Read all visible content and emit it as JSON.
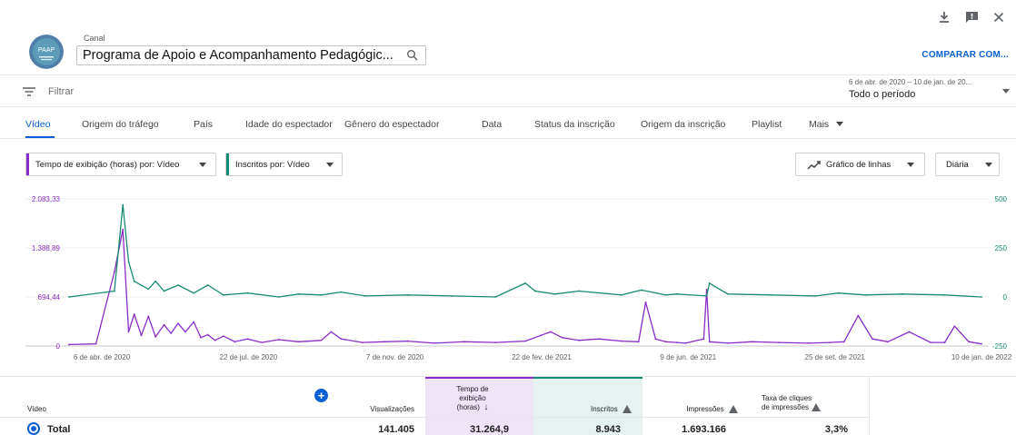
{
  "header": {
    "channel_caption": "Canal",
    "channel_name": "Programa de Apoio e Acompanhamento Pedagógic...",
    "compare_label": "COMPARAR COM...",
    "logo_text": "PAAP"
  },
  "filter": {
    "label": "Filtrar"
  },
  "date_range": {
    "range_text": "6 de abr. de 2020 – 10 de jan. de 20...",
    "period_label": "Todo o período"
  },
  "tabs": [
    {
      "label": "Vídeo",
      "active": true
    },
    {
      "label": "Origem do tráfego"
    },
    {
      "label": "País"
    },
    {
      "label": "Idade do espectador"
    },
    {
      "label": "Gênero do espectador"
    },
    {
      "label": "Data"
    },
    {
      "label": "Status da inscrição"
    },
    {
      "label": "Origem da inscrição"
    },
    {
      "label": "Playlist"
    },
    {
      "label": "Mais"
    }
  ],
  "controls": {
    "metric1_label": "Tempo de exibição (horas) por: Vídeo",
    "metric2_label": "Inscritos por: Vídeo",
    "chart_type_label": "Gráfico de linhas",
    "granularity_label": "Diária"
  },
  "colors": {
    "accent": "#065fd4",
    "metric1": "#8a2dc8",
    "metric2": "#178a73",
    "metric1_bg": "#efe3f6",
    "metric2_bg": "#e6f2ef"
  },
  "chart_data": {
    "type": "line",
    "x_tick_labels": [
      "6 de abr. de 2020",
      "22 de jul. de 2020",
      "7 de nov. de 2020",
      "22 de fev. de 2021",
      "9 de jun. de 2021",
      "25 de set. de 2021",
      "10 de jan. de 2022"
    ],
    "x_range": [
      "2020-04-06",
      "2022-01-10"
    ],
    "y_left": {
      "tick_labels": [
        "2.083,33",
        "1.388,89",
        "694,44",
        "0"
      ],
      "range": [
        0,
        2083.33
      ]
    },
    "y_right": {
      "tick_labels": [
        "500",
        "250",
        "0",
        "-250"
      ],
      "range": [
        -250,
        500
      ]
    },
    "grid": true,
    "series": [
      {
        "name": "Tempo de exibição (horas)",
        "axis": "left",
        "color": "#8a2dc8",
        "x": [
          "2020-04-06",
          "2020-04-25",
          "2020-05-08",
          "2020-05-14",
          "2020-05-18",
          "2020-05-22",
          "2020-05-27",
          "2020-06-01",
          "2020-06-06",
          "2020-06-12",
          "2020-06-17",
          "2020-06-22",
          "2020-06-27",
          "2020-07-03",
          "2020-07-08",
          "2020-07-13",
          "2020-07-18",
          "2020-07-24",
          "2020-08-01",
          "2020-08-10",
          "2020-08-20",
          "2020-09-01",
          "2020-09-15",
          "2020-10-01",
          "2020-10-08",
          "2020-10-15",
          "2020-10-30",
          "2020-11-15",
          "2020-12-01",
          "2020-12-20",
          "2021-01-10",
          "2021-02-01",
          "2021-02-22",
          "2021-03-05",
          "2021-03-12",
          "2021-03-20",
          "2021-04-01",
          "2021-04-15",
          "2021-05-01",
          "2021-05-13",
          "2021-05-18",
          "2021-05-25",
          "2021-06-01",
          "2021-06-09",
          "2021-06-15",
          "2021-06-28",
          "2021-06-30",
          "2021-07-02",
          "2021-07-15",
          "2021-08-01",
          "2021-08-20",
          "2021-09-10",
          "2021-09-25",
          "2021-10-05",
          "2021-10-15",
          "2021-10-25",
          "2021-11-05",
          "2021-11-20",
          "2021-12-05",
          "2021-12-15",
          "2021-12-22",
          "2022-01-01",
          "2022-01-10"
        ],
        "values": [
          20,
          30,
          1050,
          1650,
          200,
          450,
          150,
          420,
          130,
          300,
          180,
          320,
          200,
          340,
          120,
          160,
          80,
          140,
          60,
          100,
          50,
          90,
          60,
          80,
          200,
          100,
          50,
          60,
          70,
          40,
          60,
          50,
          70,
          150,
          200,
          120,
          80,
          100,
          70,
          60,
          620,
          100,
          60,
          50,
          40,
          100,
          800,
          60,
          40,
          60,
          50,
          40,
          50,
          60,
          430,
          100,
          60,
          200,
          50,
          50,
          280,
          60,
          30
        ]
      },
      {
        "name": "Inscritos",
        "axis": "right",
        "color": "#178a73",
        "x": [
          "2020-04-06",
          "2020-05-08",
          "2020-05-14",
          "2020-05-18",
          "2020-05-22",
          "2020-06-01",
          "2020-06-06",
          "2020-06-12",
          "2020-06-22",
          "2020-07-03",
          "2020-07-13",
          "2020-07-24",
          "2020-08-10",
          "2020-09-01",
          "2020-09-15",
          "2020-10-01",
          "2020-10-15",
          "2020-11-01",
          "2020-12-01",
          "2021-01-01",
          "2021-02-01",
          "2021-02-22",
          "2021-03-01",
          "2021-03-15",
          "2021-04-01",
          "2021-05-01",
          "2021-05-15",
          "2021-06-01",
          "2021-06-09",
          "2021-06-30",
          "2021-07-02",
          "2021-07-15",
          "2021-08-15",
          "2021-09-15",
          "2021-10-01",
          "2021-10-20",
          "2021-11-15",
          "2021-12-15",
          "2022-01-10"
        ],
        "values": [
          0,
          30,
          470,
          180,
          80,
          40,
          80,
          30,
          60,
          20,
          60,
          10,
          20,
          0,
          15,
          10,
          25,
          5,
          10,
          5,
          0,
          70,
          30,
          15,
          30,
          10,
          35,
          10,
          15,
          5,
          70,
          15,
          10,
          5,
          20,
          10,
          15,
          10,
          0
        ]
      }
    ]
  },
  "table": {
    "video_header": "Vídeo",
    "views_header": "Visualizações",
    "watch_header_lines": [
      "Tempo de",
      "exibição",
      "(horas)"
    ],
    "subs_header": "Inscritos",
    "impr_header": "Impressões",
    "ctr_header_lines": [
      "Taxa de cliques",
      "de impressões"
    ],
    "sort_arrow": "↓",
    "total_row": {
      "label": "Total",
      "views": "141.405",
      "watch": "31.264,9",
      "subs": "8.943",
      "impr": "1.693.166",
      "ctr": "3,3%"
    }
  }
}
